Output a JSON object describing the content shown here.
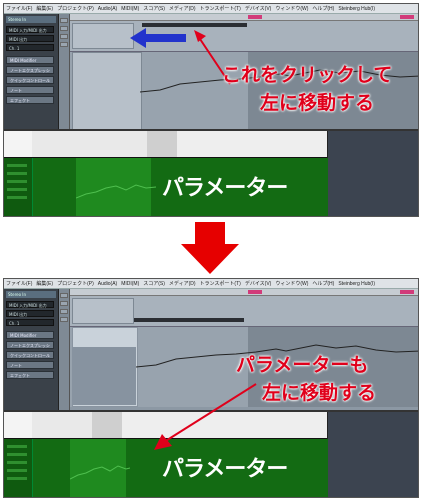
{
  "menu": [
    "ファイル(F)",
    "編集(E)",
    "プロジェクト(P)",
    "Audio(A)",
    "MIDI(M)",
    "スコア(S)",
    "メディア(D)",
    "トランスポート(T)",
    "デバイス(V)",
    "ウィンドウ(W)",
    "ヘルプ(H)",
    "Steinberg Hub(I)"
  ],
  "inspector": {
    "title": "Stereo In",
    "rows": [
      "MIDI 入力/MIDI 出力",
      "MIDI 出力",
      "Ch. 1"
    ],
    "buttons": [
      "MIDI Modifier",
      "ノートエクスプレッション",
      "クイックコントロール",
      "ノート",
      "エフェクト"
    ]
  },
  "top": {
    "annotation": [
      "これをクリックして",
      "左に移動する"
    ],
    "editor_label": "パラメーター"
  },
  "bottom": {
    "annotation": [
      "パラメーターも",
      "左に移動する"
    ],
    "editor_label": "パラメーター"
  },
  "colors": {
    "annotation_red": "#e0001b",
    "blue_arrow": "#2233cc",
    "controller_green": "#136b13",
    "marker_pink": "#d23b7a"
  }
}
